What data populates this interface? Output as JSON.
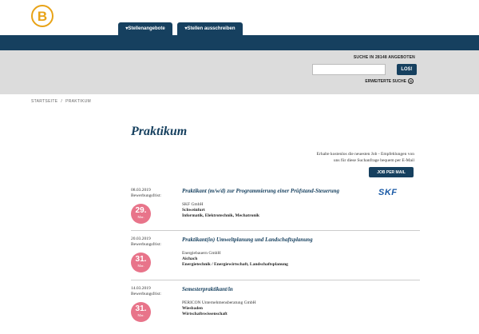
{
  "header": {
    "logo_letter": "B",
    "tabs": [
      {
        "label": "▾Stellenangebote"
      },
      {
        "label": "▾Stellen ausschreiben"
      }
    ]
  },
  "search": {
    "label": "SUCHE IN 28148 ANGEBOTEN",
    "input_value": "",
    "button_label": "LOS!",
    "advanced_label": "ERWEITERTE SUCHE",
    "advanced_icon": "⊙"
  },
  "breadcrumb": {
    "items": [
      "STARTSEITE",
      "/",
      "PRAKTIKUM"
    ]
  },
  "page": {
    "title": "Praktikum",
    "mail_text_line1": "Erhalte kostenlos die neuesten Job - Empfehlungen von",
    "mail_text_line2": "uns für diese Suchanfrage bequem per E-Mail",
    "mail_button": "JOB PER MAIL"
  },
  "jobs": [
    {
      "date": "08.03.2019",
      "deadline_label": "Bewerbungsfrist:",
      "deadline_day": "29.",
      "deadline_month": "Mar.",
      "title": "Praktikant (m/w/d) zur Programmierung einer Prüfstand-Steuerung",
      "company": "SKF GmbH",
      "location": "Schweinfurt",
      "categories": "Informatik, Elektrotechnik, Mechatronik",
      "logo_text": "SKF"
    },
    {
      "date": "20.03.2019",
      "deadline_label": "Bewerbungsfrist:",
      "deadline_day": "31.",
      "deadline_month": "Mar.",
      "title": "Praktikant(in) Umweltplanung und Landschaftsplanung",
      "company": "Energiebauern GmbH",
      "location": "Aichach",
      "categories": "Energietechnik / Energiewirtschaft, Landschaftsplanung"
    },
    {
      "date": "14.03.2019",
      "deadline_label": "Bewerbungsfrist:",
      "deadline_day": "31.",
      "deadline_month": "Mar.",
      "title": "Semesterpraktikant/in",
      "company": "PERICON Unternehmensberatung GmbH",
      "location": "Wiesbaden",
      "categories": "Wirtschaftswissenschaft"
    }
  ],
  "colors": {
    "primary": "#16405f",
    "accent": "#e8a317",
    "badge": "#e8748a",
    "gray_band": "#dcdcdc"
  }
}
